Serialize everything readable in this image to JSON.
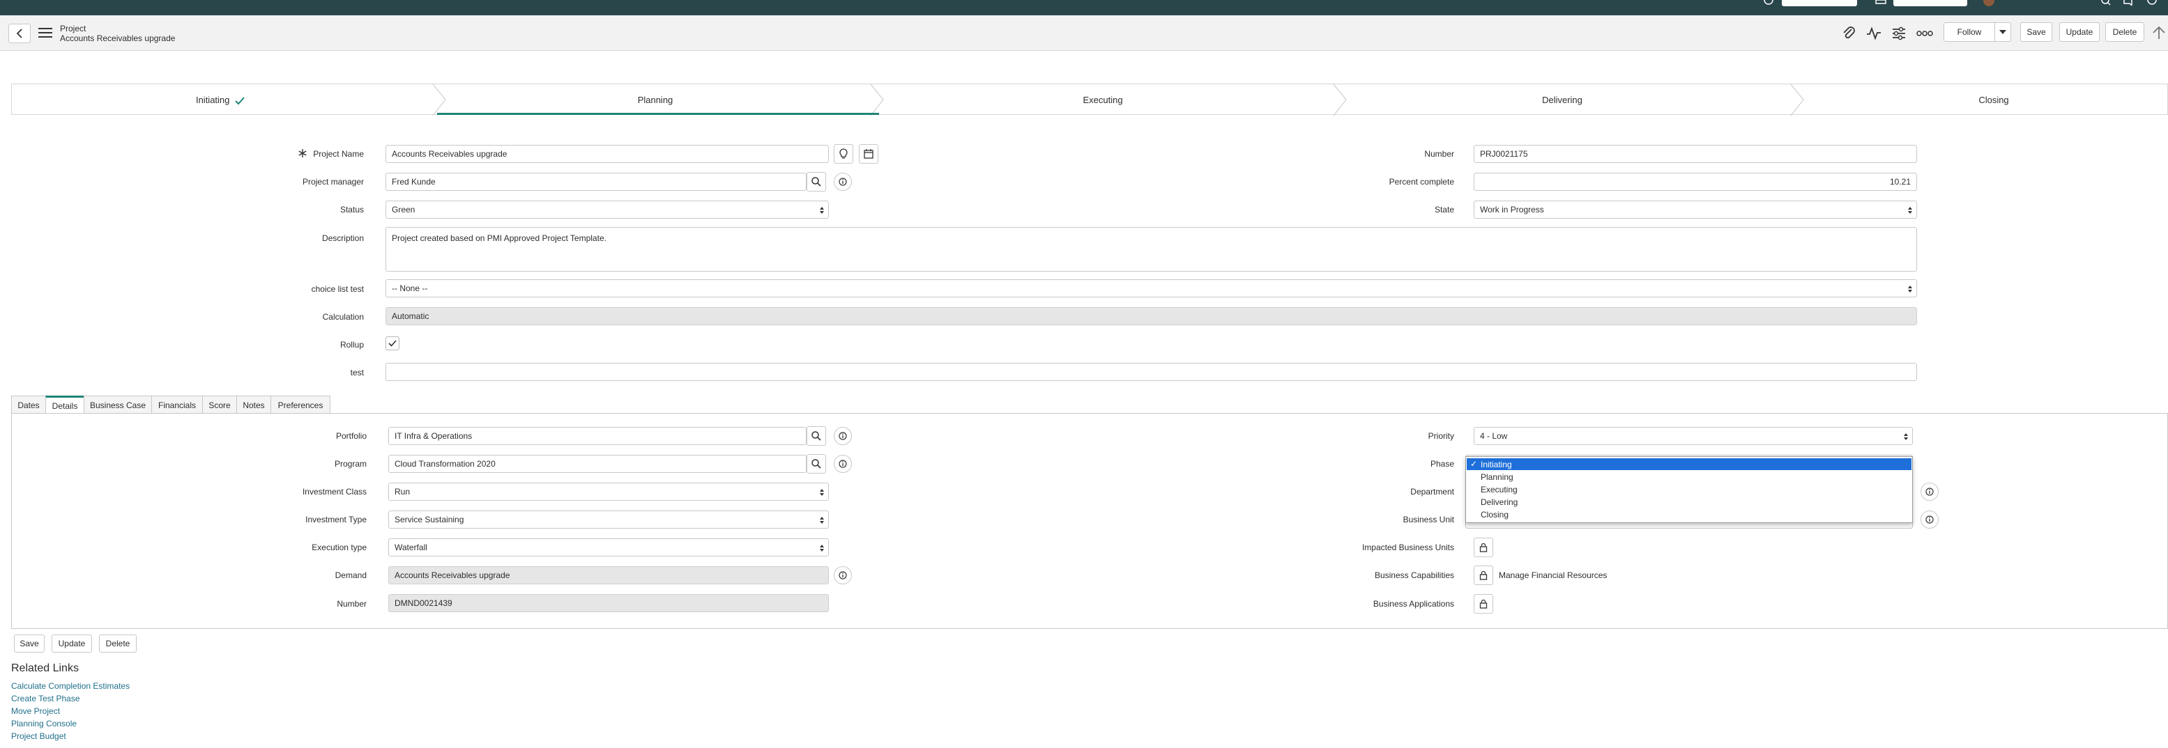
{
  "header": {
    "record_type": "Project",
    "record_title": "Accounts Receivables upgrade",
    "buttons": {
      "follow": "Follow",
      "save": "Save",
      "update": "Update",
      "delete": "Delete"
    }
  },
  "stages": [
    {
      "label": "Initiating",
      "done": true
    },
    {
      "label": "Planning",
      "current": true
    },
    {
      "label": "Executing"
    },
    {
      "label": "Delivering"
    },
    {
      "label": "Closing"
    }
  ],
  "form": {
    "project_name": {
      "label": "Project Name",
      "value": "Accounts Receivables upgrade"
    },
    "project_manager": {
      "label": "Project manager",
      "value": "Fred Kunde"
    },
    "status": {
      "label": "Status",
      "value": "Green"
    },
    "description": {
      "label": "Description",
      "value": "Project created based on PMI Approved Project Template."
    },
    "choice_list_test": {
      "label": "choice list test",
      "value": "-- None --"
    },
    "calculation": {
      "label": "Calculation",
      "value": "Automatic"
    },
    "rollup": {
      "label": "Rollup",
      "checked": true
    },
    "test": {
      "label": "test",
      "value": ""
    },
    "number": {
      "label": "Number",
      "value": "PRJ0021175"
    },
    "percent_complete": {
      "label": "Percent complete",
      "value": "10.21"
    },
    "state": {
      "label": "State",
      "value": "Work in Progress"
    }
  },
  "tabs": [
    "Dates",
    "Details",
    "Business Case",
    "Financials",
    "Score",
    "Notes",
    "Preferences"
  ],
  "active_tab": "Details",
  "details": {
    "portfolio": {
      "label": "Portfolio",
      "value": "IT Infra & Operations"
    },
    "program": {
      "label": "Program",
      "value": "Cloud Transformation 2020"
    },
    "investment_class": {
      "label": "Investment Class",
      "value": "Run"
    },
    "investment_type": {
      "label": "Investment Type",
      "value": "Service Sustaining"
    },
    "execution_type": {
      "label": "Execution type",
      "value": "Waterfall"
    },
    "demand": {
      "label": "Demand",
      "value": "Accounts Receivables upgrade"
    },
    "demand_number": {
      "label": "Number",
      "value": "DMND0021439"
    },
    "priority": {
      "label": "Priority",
      "value": "4 - Low"
    },
    "phase": {
      "label": "Phase",
      "value": "Initiating"
    },
    "department": {
      "label": "Department"
    },
    "business_unit": {
      "label": "Business Unit"
    },
    "impacted_business_units": {
      "label": "Impacted Business Units"
    },
    "business_capabilities": {
      "label": "Business Capabilities",
      "value": "Manage Financial Resources"
    },
    "business_applications": {
      "label": "Business Applications"
    }
  },
  "phase_dropdown": {
    "options": [
      "Initiating",
      "Planning",
      "Executing",
      "Delivering",
      "Closing"
    ],
    "selected": "Initiating",
    "check": "✓"
  },
  "bottom_buttons": {
    "save": "Save",
    "update": "Update",
    "delete": "Delete"
  },
  "related_links": {
    "title": "Related Links",
    "items": [
      "Calculate Completion Estimates",
      "Create Test Phase",
      "Move Project",
      "Planning Console",
      "Project Budget"
    ]
  },
  "colors": {
    "accent": "#1f8476",
    "topbar": "#29464b",
    "link": "#1f6f8b",
    "dropdown_selected": "#1e6fd9"
  }
}
